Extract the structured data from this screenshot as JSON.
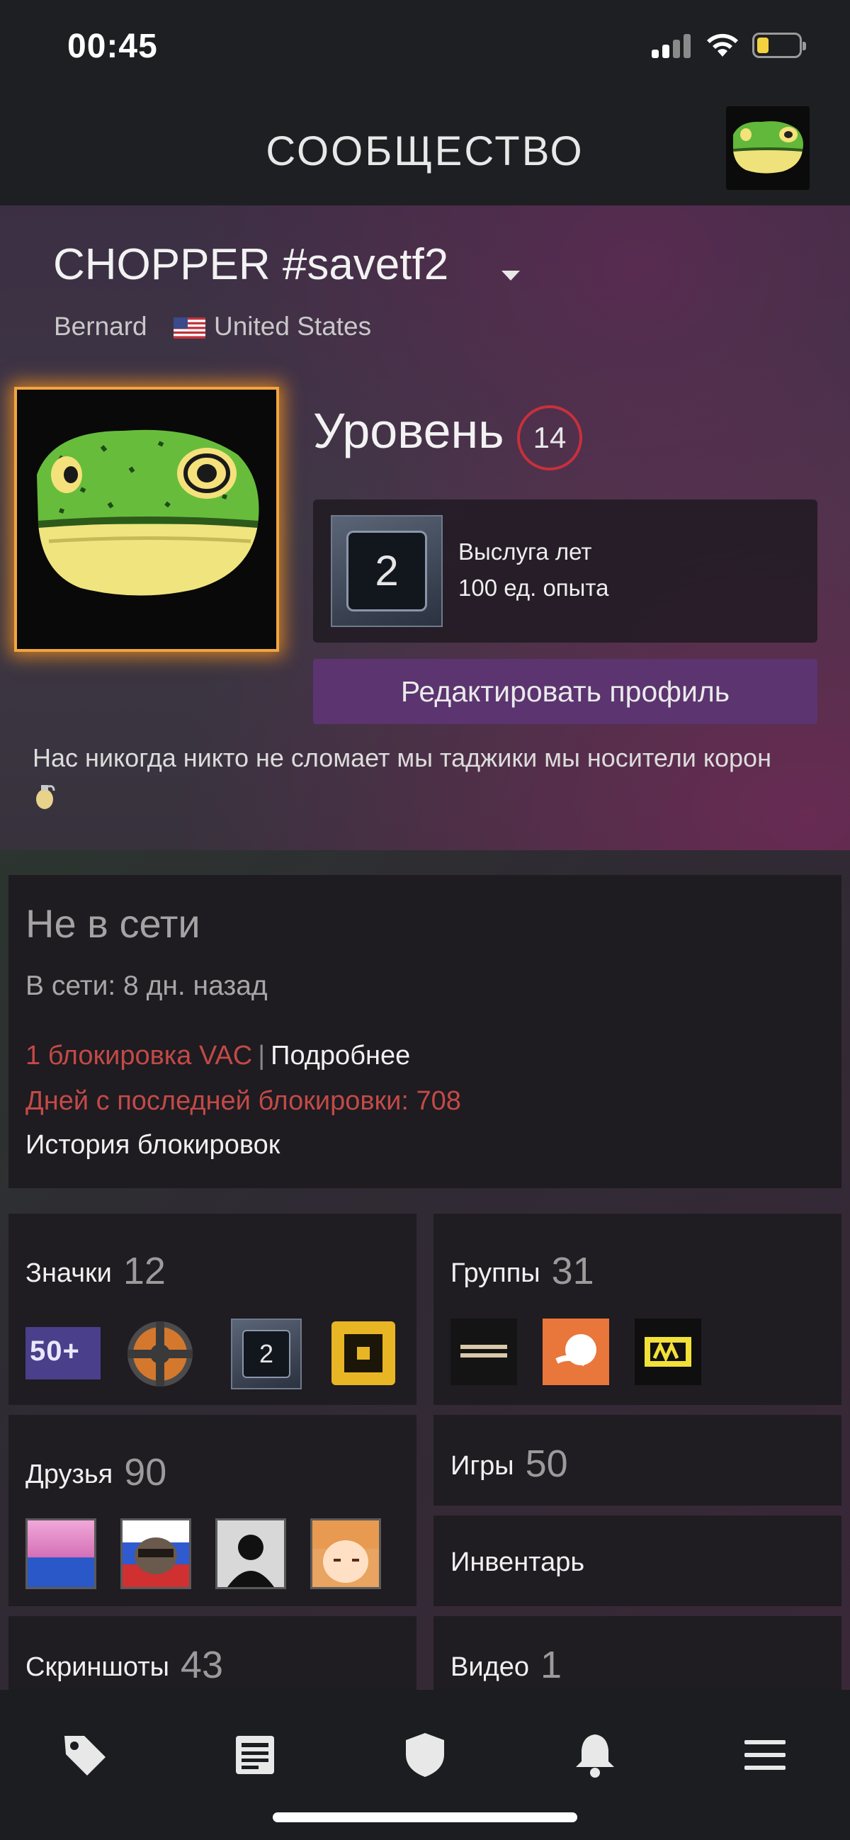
{
  "status_bar": {
    "time": "00:45"
  },
  "header": {
    "title": "СООБЩЕСТВО"
  },
  "profile": {
    "name": "CHOPPER #savetf2",
    "real_name": "Bernard",
    "country": "United States",
    "level_label": "Уровень",
    "level": "14",
    "xp_badge_number": "2",
    "xp_badge_title": "Выслуга лет",
    "xp_badge_xp": "100 ед. опыта",
    "edit_button": "Редактировать профиль",
    "bio": "Нас никогда никто не сломает мы таджики мы носители корон"
  },
  "status": {
    "title": "Не в сети",
    "last_online": "В сети: 8 дн. назад",
    "vac": "1 блокировка VAC",
    "separator": "|",
    "details_link": "Подробнее",
    "days_since_ban": "Дней с последней блокировки: 708",
    "ban_history": "История блокировок"
  },
  "tiles": {
    "badges": {
      "label": "Значки",
      "count": "12",
      "badge_50_text": "50+",
      "years_badge_number": "2"
    },
    "groups": {
      "label": "Группы",
      "count": "31"
    },
    "friends": {
      "label": "Друзья",
      "count": "90"
    },
    "games": {
      "label": "Игры",
      "count": "50"
    },
    "inventory": {
      "label": "Инвентарь"
    },
    "screenshots": {
      "label": "Скриншоты",
      "count": "43"
    },
    "videos": {
      "label": "Видео",
      "count": "1"
    }
  },
  "nav": {
    "items": [
      "tag-icon",
      "news-icon",
      "shield-icon",
      "bell-icon",
      "menu-icon"
    ]
  },
  "colors": {
    "accent_purple": "#5b3470",
    "vac_red": "#c24a46",
    "level_ring": "#c7303c",
    "frame_glow": "#f0a640"
  }
}
